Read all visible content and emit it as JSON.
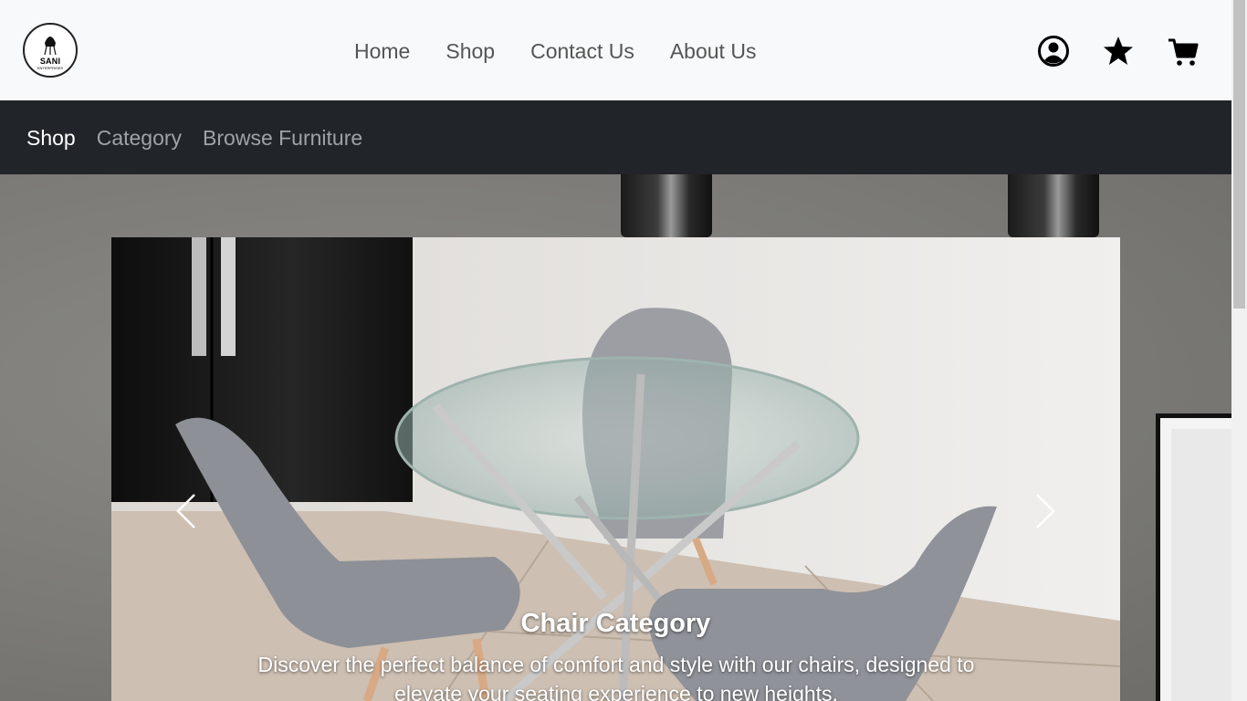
{
  "brand": {
    "logo_text": "SANI",
    "logo_subtext": "ENTERPRISES"
  },
  "main_nav": [
    "Home",
    "Shop",
    "Contact Us",
    "About Us"
  ],
  "header_icons": [
    "user-icon",
    "star-icon",
    "cart-icon"
  ],
  "sub_nav": {
    "brand": "Shop",
    "links": [
      "Category",
      "Browse Furniture"
    ]
  },
  "carousel": {
    "title": "Chair Category",
    "description": "Discover the perfect balance of comfort and style with our chairs, designed to elevate your seating experience to new heights.",
    "prev_icon": "chevron-left-icon",
    "next_icon": "chevron-right-icon"
  },
  "colors": {
    "subnav_bg": "#212529",
    "topbar_bg": "#f8f9fa",
    "text_muted": "#555555"
  }
}
